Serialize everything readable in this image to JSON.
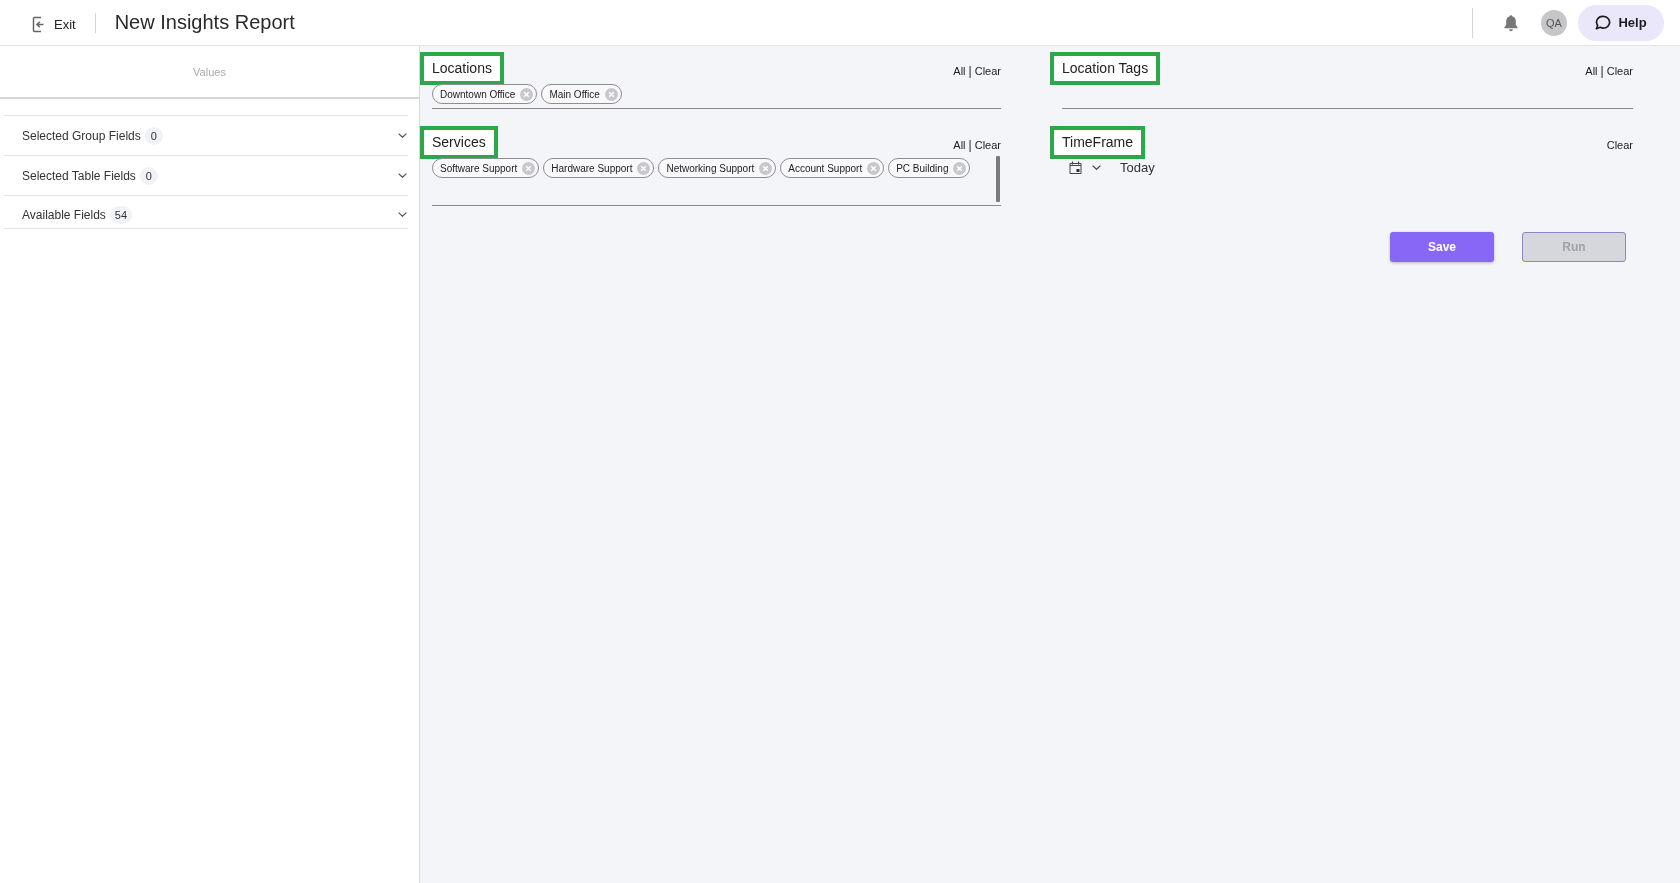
{
  "header": {
    "exit": {
      "label": "Exit"
    },
    "title": "New Insights Report",
    "avatar": {
      "initials": "QA"
    },
    "help": {
      "label": "Help"
    }
  },
  "sidebar": {
    "title": "Values",
    "sections": [
      {
        "label": "Selected Group Fields",
        "count": "0",
        "expanded": false
      },
      {
        "label": "Selected Table Fields",
        "count": "0",
        "expanded": false
      },
      {
        "label": "Available Fields",
        "count": "54",
        "expanded": false
      }
    ]
  },
  "filters": [
    {
      "kind": "chips",
      "title": "Locations",
      "highlighted": true,
      "actions": [
        "All",
        "Clear"
      ],
      "separator": "|",
      "chips": [
        "Downtown Office",
        "Main Office"
      ],
      "scrollbar": false
    },
    {
      "kind": "chips",
      "title": "Location Tags",
      "highlighted": true,
      "actions": [
        "All",
        "Clear"
      ],
      "separator": "|",
      "scrollbar": false
    },
    {
      "kind": "chips",
      "title": "Services",
      "highlighted": true,
      "actions": [
        "All",
        "Clear"
      ],
      "separator": "|",
      "chips": [
        "Software Support",
        "Hardware Support",
        "Networking Support",
        "Account Support",
        "PC Building"
      ],
      "scrollbar": true
    },
    {
      "kind": "timeframe",
      "title": "TimeFrame",
      "highlighted": true,
      "actions": [
        "Clear"
      ],
      "value": "Today"
    }
  ],
  "buttons": [
    {
      "label": "Save",
      "kind": "primary",
      "disabled": false
    },
    {
      "label": "Run",
      "kind": "secondary",
      "disabled": true
    }
  ]
}
